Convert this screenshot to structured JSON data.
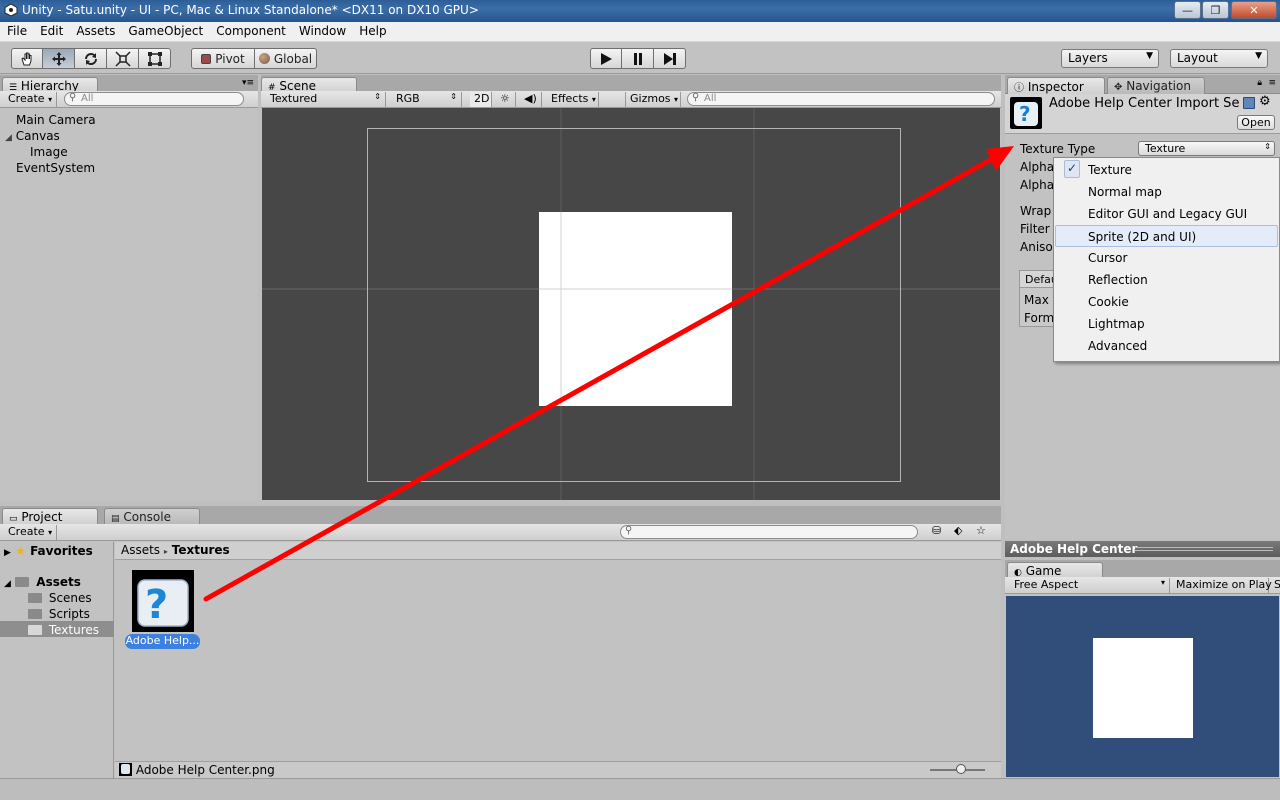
{
  "window": {
    "title": "Unity - Satu.unity - UI - PC, Mac & Linux Standalone* <DX11 on DX10 GPU>",
    "minimize_glyph": "—",
    "maximize_glyph": "❐",
    "close_glyph": "✕"
  },
  "menu": [
    "File",
    "Edit",
    "Assets",
    "GameObject",
    "Component",
    "Window",
    "Help"
  ],
  "toolbar": {
    "pivot_label": "Pivot",
    "global_label": "Global",
    "layers_label": "Layers",
    "layout_label": "Layout"
  },
  "hierarchy": {
    "tab_label": "Hierarchy",
    "create_label": "Create",
    "search_placeholder": "All",
    "items": [
      "Main Camera",
      "Canvas",
      "Image",
      "EventSystem"
    ]
  },
  "scene": {
    "tab_label": "Scene",
    "render_mode": "Textured",
    "color_mode": "RGB",
    "mode_2d": "2D",
    "effects_label": "Effects",
    "gizmos_label": "Gizmos",
    "search_placeholder": "All"
  },
  "inspector": {
    "tab_label": "Inspector",
    "nav_tab_label": "Navigation",
    "asset_title": "Adobe Help Center Import Se",
    "open_button": "Open",
    "texture_type_label": "Texture Type",
    "texture_type_value": "Texture",
    "partial_labels": [
      "Alpha",
      "Alpha",
      "Wrap",
      "Filter",
      "Aniso",
      "Defau",
      "Max",
      "Form"
    ],
    "dropdown_options": [
      "Texture",
      "Normal map",
      "Editor GUI and Legacy GUI",
      "Sprite (2D and UI)",
      "Cursor",
      "Reflection",
      "Cookie",
      "Lightmap",
      "Advanced"
    ],
    "dropdown_checked": "Texture",
    "dropdown_highlighted": "Sprite (2D and UI)"
  },
  "preview": {
    "header_label": "Adobe Help Center"
  },
  "project": {
    "tab_label": "Project",
    "console_tab_label": "Console",
    "create_label": "Create",
    "favorites_label": "Favorites",
    "assets_label": "Assets",
    "folders": [
      "Scenes",
      "Scripts",
      "Textures"
    ],
    "selected_folder": "Textures",
    "breadcrumb_root": "Assets",
    "breadcrumb_sep": "▸",
    "breadcrumb_current": "Textures",
    "asset_item_label": "Adobe Help...",
    "footer_file": "Adobe Help Center.png"
  },
  "game": {
    "tab_label": "Game",
    "aspect_label": "Free Aspect",
    "maximize_label": "Maximize on Play",
    "partial_label": "S",
    "background_color": "#314d79"
  },
  "colors": {
    "annotation_arrow": "#ff0000",
    "scene_background": "#474747",
    "selection_blue": "#3d80df"
  }
}
